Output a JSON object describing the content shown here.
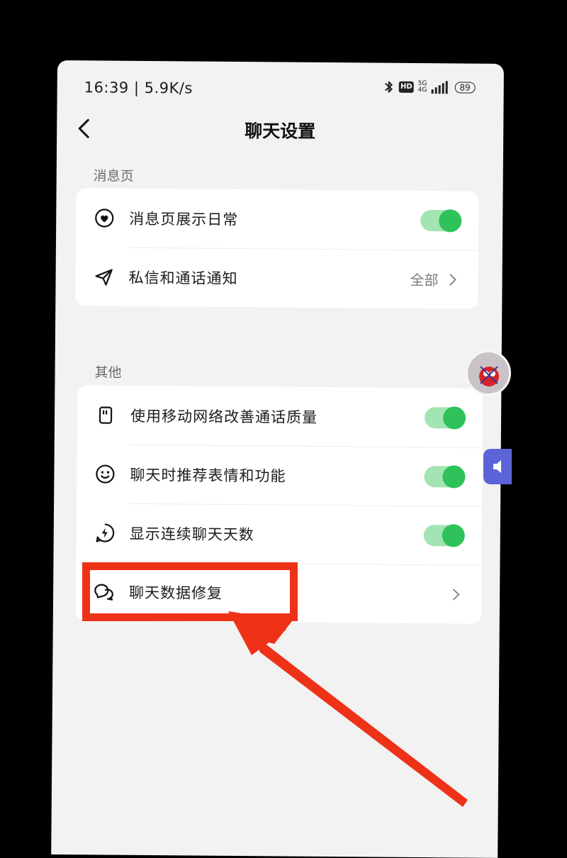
{
  "status_bar": {
    "time": "16:39 | 5.9K/s",
    "hd": "HD",
    "network": "5G",
    "network_sub": "4G",
    "battery": "89"
  },
  "header": {
    "title": "聊天设置",
    "back_icon": "chevron-left-icon"
  },
  "sections": [
    {
      "label": "消息页",
      "rows": [
        {
          "label": "消息页展示日常",
          "icon": "heart-circle-icon",
          "toggle": true
        },
        {
          "label": "私信和通话通知",
          "icon": "send-icon",
          "value": "全部"
        }
      ]
    },
    {
      "label": "其他",
      "rows": [
        {
          "label": "使用移动网络改善通话质量",
          "icon": "sim-card-icon",
          "toggle": true
        },
        {
          "label": "聊天时推荐表情和功能",
          "icon": "smiley-icon",
          "toggle": true
        },
        {
          "label": "显示连续聊天天数",
          "icon": "lightning-circle-icon",
          "toggle": true
        },
        {
          "label": "聊天数据修复",
          "icon": "chat-bubbles-icon"
        }
      ]
    }
  ],
  "colors": {
    "toggle_on": "#2fc25b",
    "toggle_track": "#a3e4b3",
    "annotation": "#ee3217",
    "background": "#f2f2f2"
  }
}
